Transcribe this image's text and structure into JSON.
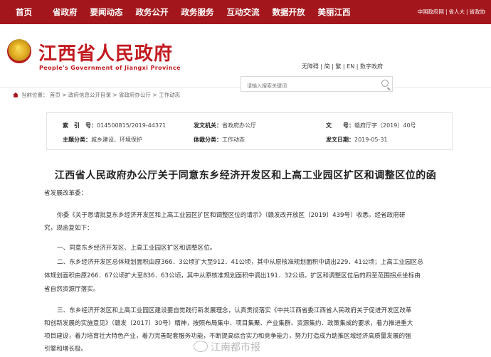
{
  "topnav": {
    "items": [
      "首页",
      "省政府",
      "要闻动态",
      "政务公开",
      "政务服务",
      "互动交流",
      "数据开放",
      "美丽江西"
    ],
    "right_links": [
      "中国政府网",
      "省人大",
      "省政协"
    ]
  },
  "header": {
    "title_cn": "江西省人民政府",
    "title_en": "People's Government of Jiangxi Province",
    "lang_links": [
      "无障碍",
      "简",
      "繁",
      "EN",
      "数字政府"
    ],
    "search_placeholder": "请输入搜索关键词"
  },
  "breadcrumb": {
    "label": "当前位置：",
    "path": [
      "首页",
      "政府信息公开目录",
      "省政府办公厅",
      "工作动态"
    ]
  },
  "meta": {
    "index_label": "索　引　号：",
    "index_value": "014500815/2019-44371",
    "org_label": "发文机关：",
    "org_value": "省政府办公厅",
    "docno_label": "文　　号：",
    "docno_value": "赣府厅字〔2019〕40号",
    "topic_label": "主题分类：",
    "topic_value": "城乡建设、环境保护",
    "type_label": "体裁分类：",
    "type_value": "工作动态",
    "date_label": "发文日期：",
    "date_value": "2019-05-31"
  },
  "doc": {
    "title": "江西省人民政府办公厅关于同意东乡经济开发区和上高工业园区扩区和调整区位的函",
    "salutation": "省发展改革委：",
    "p1a": "你委《关于恳请批复东乡经济开发区和上高工业园区扩区和调整区位的请示》（赣发改开放区〔2019〕439号）收悉。经省政府研",
    "p1b": "究，现函复如下：",
    "p2": "一、同意东乡经济开发区、上高工业园区扩区和调整区位。",
    "p3a": "二、东乡经济开发区总体规划面积由原366．3公顷扩大至912．41公顷，其中从原核准规划面积中调出229．41公顷；上高工业园区总",
    "p3b": "体规划面积由原266．67公顷扩大至836．63公顷，其中从原核准规划面积中调出191．32公顷。扩区和调整区位后的四至范围拐点坐标由",
    "p3c": "省自然资源厅落实。",
    "p4a": "三、东乡经济开发区和上高工业园区建设要自觉践行新发展理念，认真贯彻落实《中共江西省委江西省人民政府关于促进开发区改革",
    "p4b": "和创新发展的实施意见》（赣发〔2017〕30号）精神，按照布局集中、项目集聚、产业集群、资源集约、政策集成的要求，着力推进重大",
    "p4c": "项目建设，着力培育壮大特色产业，着力完善配套服务功能，不断提高综合实力和竞争能力，努力打造成为助推区域经济高质量发展的强",
    "p4d": "引擎和增长极。"
  },
  "watermark": "江南都市报"
}
